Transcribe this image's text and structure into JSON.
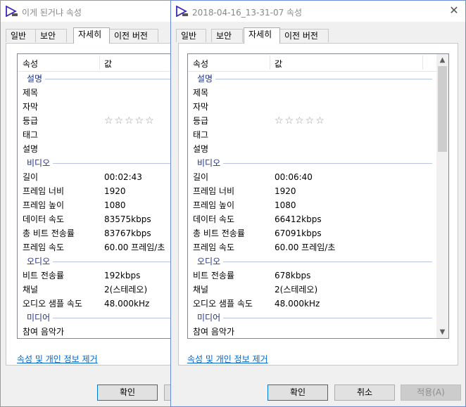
{
  "win1": {
    "title": "이게 된거냐 속성",
    "tabs": [
      "일반",
      "보안",
      "자세히",
      "이전 버전"
    ],
    "header": {
      "property": "속성",
      "value": "값"
    },
    "description_group": "설명",
    "desc_rows": [
      "제목",
      "자막",
      "등급",
      "태그",
      "설명"
    ],
    "rating_stars": "☆☆☆☆☆",
    "video_group": "비디오",
    "video_rows": [
      {
        "k": "길이",
        "v": "00:02:43"
      },
      {
        "k": "프레임 너비",
        "v": "1920"
      },
      {
        "k": "프레임 높이",
        "v": "1080"
      },
      {
        "k": "데이터 속도",
        "v": "83575kbps"
      },
      {
        "k": "총 비트 전송률",
        "v": "83767kbps"
      },
      {
        "k": "프레임 속도",
        "v": "60.00 프레임/초"
      }
    ],
    "audio_group": "오디오",
    "audio_rows": [
      {
        "k": "비트 전송률",
        "v": "192kbps"
      },
      {
        "k": "채널",
        "v": "2(스테레오)"
      },
      {
        "k": "오디오 샘플 속도",
        "v": "48.000kHz"
      }
    ],
    "media_group": "미디어",
    "media_rows": [
      "참여 음악가"
    ],
    "remove_link": "속성 및 개인 정보 제거",
    "ok": "확인"
  },
  "win2": {
    "title": "2018-04-16_13-31-07 속성",
    "tabs": [
      "일반",
      "보안",
      "자세히",
      "이전 버전"
    ],
    "header": {
      "property": "속성",
      "value": "값"
    },
    "description_group": "설명",
    "desc_rows": [
      "제목",
      "자막",
      "등급",
      "태그",
      "설명"
    ],
    "rating_stars": "☆☆☆☆☆",
    "video_group": "비디오",
    "video_rows": [
      {
        "k": "길이",
        "v": "00:06:40"
      },
      {
        "k": "프레임 너비",
        "v": "1920"
      },
      {
        "k": "프레임 높이",
        "v": "1080"
      },
      {
        "k": "데이터 속도",
        "v": "66412kbps"
      },
      {
        "k": "총 비트 전송률",
        "v": "67091kbps"
      },
      {
        "k": "프레임 속도",
        "v": "60.00 프레임/초"
      }
    ],
    "audio_group": "오디오",
    "audio_rows": [
      {
        "k": "비트 전송률",
        "v": "678kbps"
      },
      {
        "k": "채널",
        "v": "2(스테레오)"
      },
      {
        "k": "오디오 샘플 속도",
        "v": "48.000kHz"
      }
    ],
    "media_group": "미디어",
    "media_rows": [
      "참여 음악가"
    ],
    "remove_link": "속성 및 개인 정보 제거",
    "ok": "확인",
    "cancel": "취소",
    "apply": "적용(A)",
    "scroll_up": "▲",
    "scroll_down": "▼"
  },
  "colors": {
    "link": "#0066cc",
    "group_label": "#1e3287",
    "focus_border": "#0078d7"
  },
  "icons": {
    "app": "media-player-icon",
    "close": "close-icon"
  }
}
